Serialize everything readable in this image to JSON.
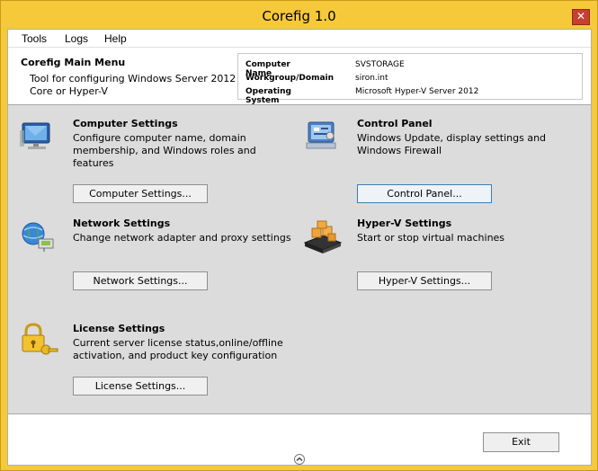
{
  "window": {
    "title": "Corefig 1.0",
    "close_glyph": "✕"
  },
  "menu": {
    "items": [
      "Tools",
      "Logs",
      "Help"
    ]
  },
  "header": {
    "title": "Corefig Main Menu",
    "description": "Tool for configuring Windows Server 2012 Core or Hyper-V",
    "info": [
      {
        "label": "Computer Name",
        "value": "SVSTORAGE"
      },
      {
        "label": "Workgroup/Domain",
        "value": "siron.int"
      },
      {
        "label": "Operating System",
        "value": "Microsoft Hyper-V Server 2012"
      }
    ]
  },
  "sections": {
    "computer": {
      "title": "Computer Settings",
      "description": "Configure computer name, domain membership, and Windows roles and features",
      "button": "Computer Settings...",
      "icon": "computer-monitor-icon"
    },
    "control": {
      "title": "Control Panel",
      "description": "Windows Update, display settings and Windows Firewall",
      "button": "Control Panel...",
      "icon": "control-panel-icon"
    },
    "network": {
      "title": "Network Settings",
      "description": "Change network adapter and proxy settings",
      "button": "Network Settings...",
      "icon": "network-globe-icon"
    },
    "hyperv": {
      "title": "Hyper-V Settings",
      "description": "Start or stop virtual machines",
      "button": "Hyper-V Settings...",
      "icon": "server-boxes-icon"
    },
    "license": {
      "title": "License Settings",
      "description": "Current server license status,online/offline activation, and product key configuration",
      "button": "License Settings...",
      "icon": "key-lock-icon"
    }
  },
  "footer": {
    "exit_label": "Exit",
    "collapse_icon": "chevron-up-icon"
  },
  "colors": {
    "window_frame": "#f6c93a",
    "close": "#c7402f",
    "content_bg": "#dcdcdc",
    "focus_border": "#3c7fb1"
  }
}
